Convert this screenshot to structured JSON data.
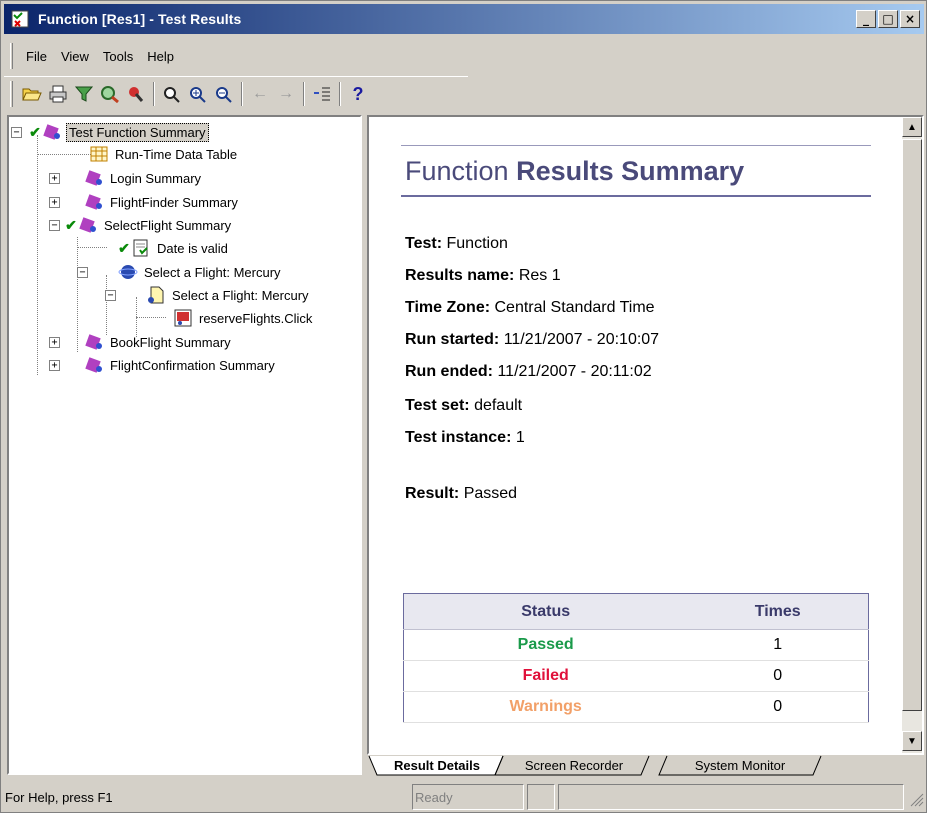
{
  "window": {
    "title": "Function [Res1] - Test Results",
    "controls": [
      "_",
      "□",
      "×"
    ]
  },
  "menu": [
    {
      "label": "File"
    },
    {
      "label": "View"
    },
    {
      "label": "Tools"
    },
    {
      "label": "Help"
    }
  ],
  "tree": {
    "root": "Test Function Summary",
    "items": {
      "run_time": "Run-Time Data Table",
      "login": "Login Summary",
      "flightfinder": "FlightFinder Summary",
      "selectflight": "SelectFlight Summary",
      "date_valid": "Date is valid",
      "select_flight_action": "Select a Flight: Mercury",
      "select_flight_page": "Select a Flight: Mercury",
      "reserve_click": "reserveFlights.Click",
      "bookflight": "BookFlight Summary",
      "confirmation": "FlightConfirmation Summary"
    }
  },
  "summary": {
    "title_plain": "Function",
    "title_bold": "Results Summary",
    "test_label": "Test:",
    "test_value": "Function",
    "results_name_label": "Results name:",
    "results_name_value": "Res 1",
    "time_zone_label": "Time Zone:",
    "time_zone_value": "Central Standard Time",
    "run_started_label": "Run started:",
    "run_started_value": "11/21/2007 - 20:10:07",
    "run_ended_label": "Run ended:",
    "run_ended_value": "11/21/2007 - 20:11:02",
    "test_set_label": "Test set:",
    "test_set_value": "default",
    "test_instance_label": "Test instance:",
    "test_instance_value": "1",
    "result_label": "Result:",
    "result_value": "Passed"
  },
  "status_table": {
    "headers": {
      "status": "Status",
      "times": "Times"
    },
    "rows": [
      {
        "label": "Passed",
        "value": "1",
        "color": "#1a9a4a"
      },
      {
        "label": "Failed",
        "value": "0",
        "color": "#e0103a"
      },
      {
        "label": "Warnings",
        "value": "0",
        "color": "#f2a068"
      }
    ]
  },
  "tabs": [
    "Result Details",
    "Screen Recorder",
    "System Monitor"
  ],
  "statusbar": {
    "help": "For Help, press F1",
    "ready": "Ready"
  }
}
